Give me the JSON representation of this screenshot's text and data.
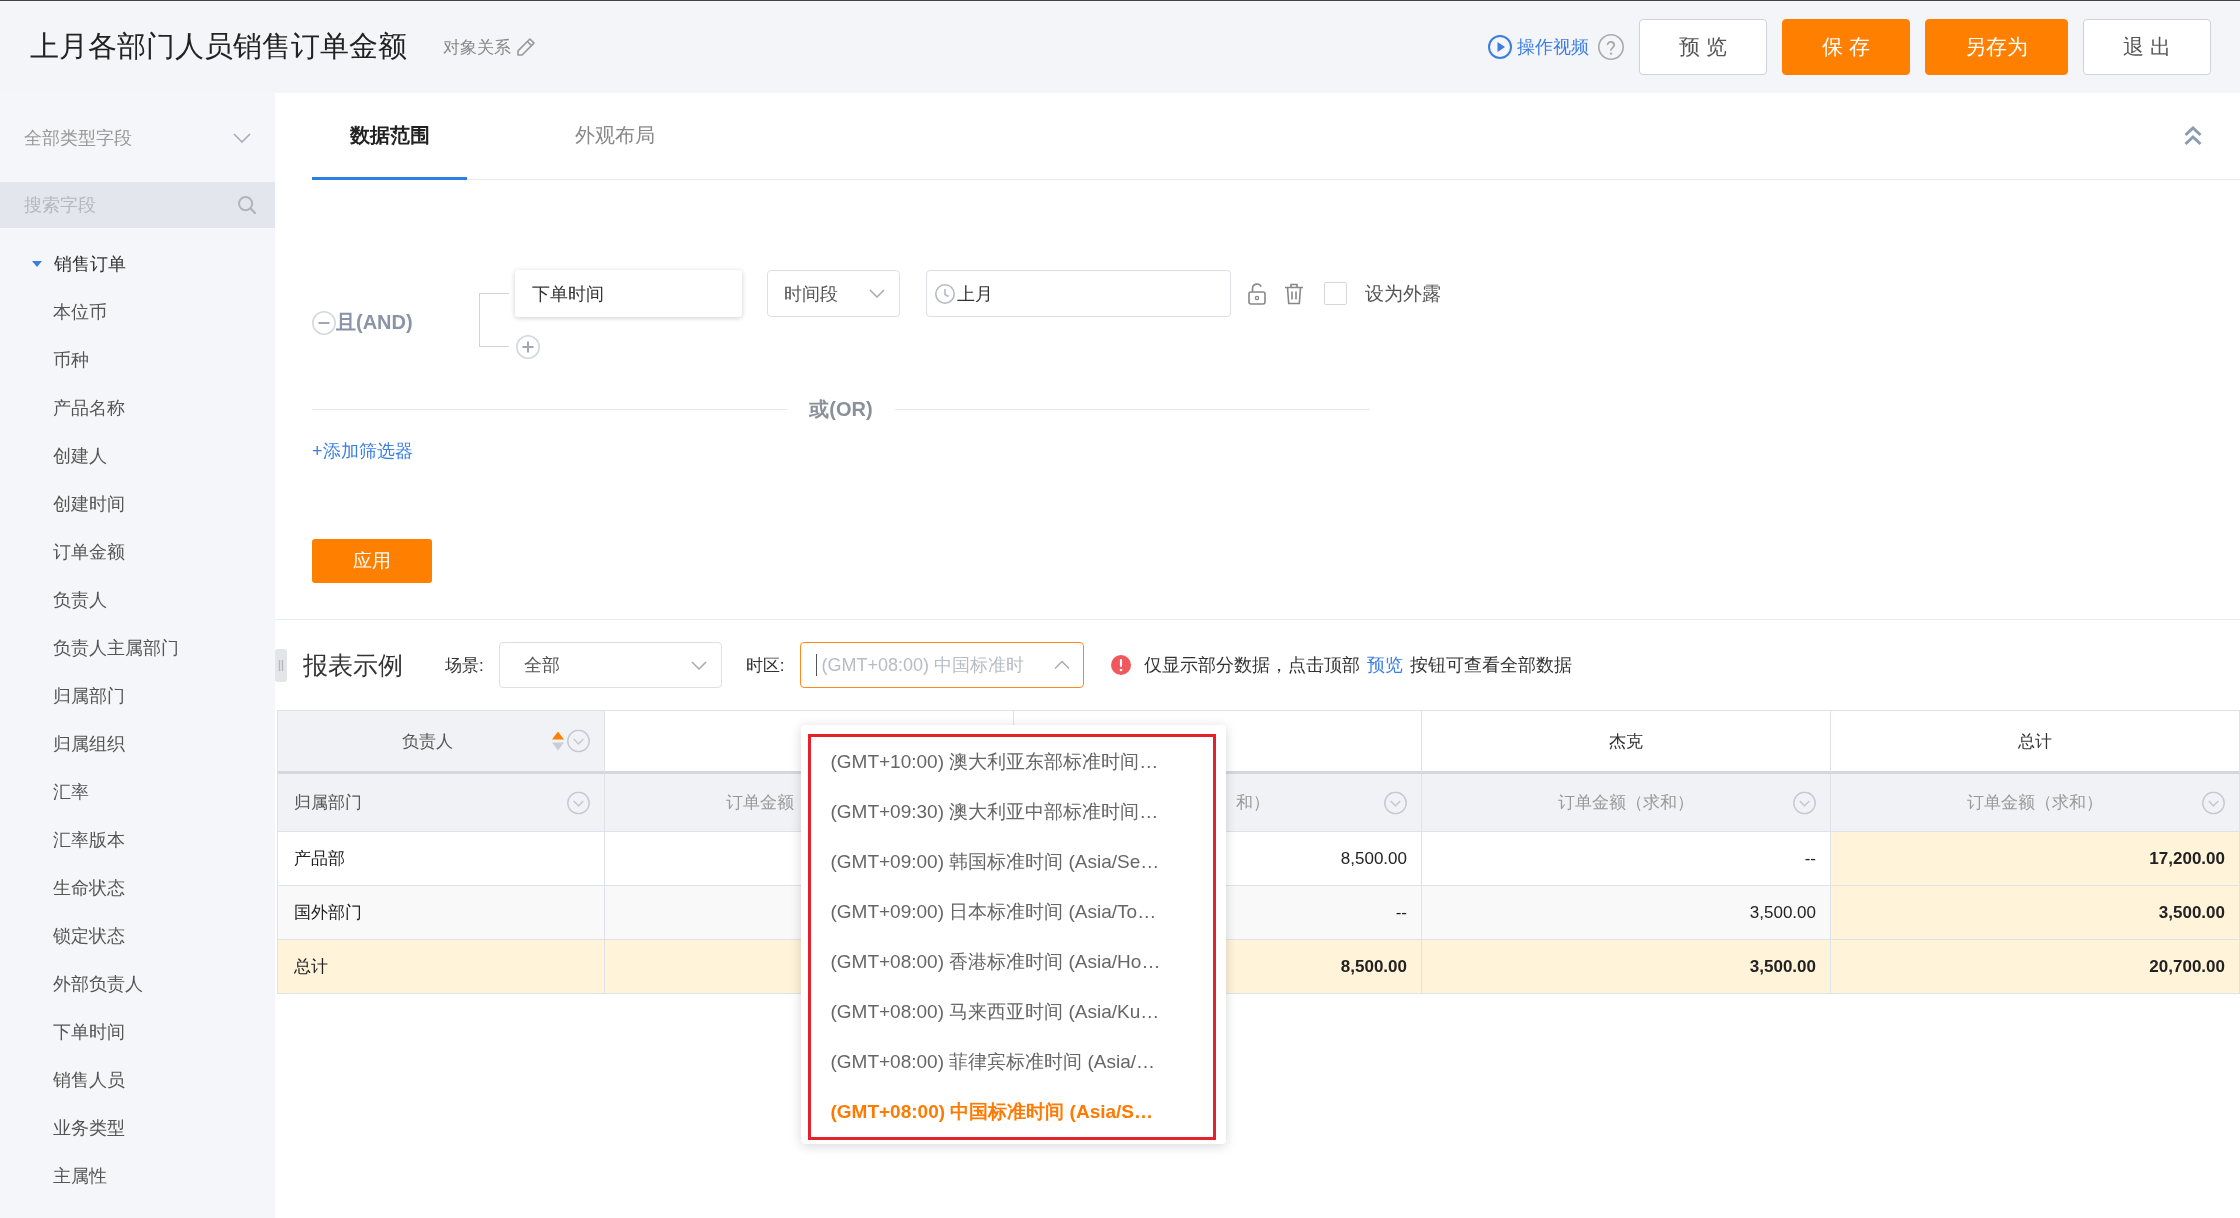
{
  "header": {
    "title": "上月各部门人员销售订单金额",
    "relation_label": "对象关系",
    "video_link": "操作视频",
    "buttons": [
      {
        "label": "预 览",
        "kind": "secondary"
      },
      {
        "label": "保 存",
        "kind": "primary"
      },
      {
        "label": "另存为",
        "kind": "primary"
      },
      {
        "label": "退 出",
        "kind": "secondary"
      }
    ]
  },
  "sidebar": {
    "type_select": "全部类型字段",
    "search": {
      "placeholder": "搜索字段"
    },
    "tree": [
      {
        "label": "销售订单",
        "expanded": true,
        "children": [
          {
            "label": "本位币"
          },
          {
            "label": "币种"
          },
          {
            "label": "产品名称"
          },
          {
            "label": "创建人"
          },
          {
            "label": "创建时间"
          },
          {
            "label": "订单金额"
          },
          {
            "label": "负责人"
          },
          {
            "label": "负责人主属部门"
          },
          {
            "label": "归属部门"
          },
          {
            "label": "归属组织"
          },
          {
            "label": "汇率"
          },
          {
            "label": "汇率版本"
          },
          {
            "label": "生命状态"
          },
          {
            "label": "锁定状态"
          },
          {
            "label": "外部负责人"
          },
          {
            "label": "下单时间"
          },
          {
            "label": "销售人员"
          },
          {
            "label": "业务类型"
          },
          {
            "label": "主属性"
          }
        ]
      }
    ]
  },
  "tabs": [
    {
      "label": "数据范围",
      "selected": true
    },
    {
      "label": "外观布局",
      "selected": false
    }
  ],
  "filter": {
    "logic_label": "且(AND)",
    "conditions": [
      {
        "field": "下单时间",
        "operator": "时间段",
        "value": "上月",
        "exposed": false,
        "exposed_label": "设为外露"
      }
    ],
    "or_label": "或(OR)",
    "add_filter": "+添加筛选器",
    "apply_button": "应用"
  },
  "report": {
    "title": "报表示例",
    "scene_label": "场景:",
    "scene_value": "全部",
    "timezone": {
      "label": "时区:",
      "placeholder": "(GMT+08:00) 中国标准时",
      "open": true,
      "highlighted": true,
      "options": [
        {
          "label": "(GMT+10:00) 澳大利亚东部标准时间…",
          "selected": false
        },
        {
          "label": "(GMT+09:30) 澳大利亚中部标准时间…",
          "selected": false
        },
        {
          "label": "(GMT+09:00) 韩国标准时间 (Asia/Se…",
          "selected": false
        },
        {
          "label": "(GMT+09:00) 日本标准时间 (Asia/To…",
          "selected": false
        },
        {
          "label": "(GMT+08:00) 香港标准时间 (Asia/Ho…",
          "selected": false
        },
        {
          "label": "(GMT+08:00) 马来西亚时间 (Asia/Ku…",
          "selected": false
        },
        {
          "label": "(GMT+08:00) 菲律宾标准时间 (Asia/…",
          "selected": false
        },
        {
          "label": "(GMT+08:00) 中国标准时间 (Asia/S…",
          "selected": true
        }
      ]
    },
    "notice": {
      "before": "仅显示部分数据，点击顶部",
      "link": "预览",
      "after": "按钮可查看全部数据"
    }
  },
  "table": {
    "columns": [
      {
        "heading": "负责人",
        "subheading": "归属部门",
        "sort_ascending": true
      },
      {
        "subheading": "订单金额"
      },
      {
        "subheading": "和）"
      },
      {
        "heading": "杰克",
        "subheading": "订单金额（求和）"
      },
      {
        "heading": "总计",
        "subheading": "订单金额（求和）",
        "total": true
      }
    ],
    "rows": [
      {
        "label": "产品部",
        "total": false,
        "cells": [
          "8,500.00",
          "--",
          "17,200.00"
        ]
      },
      {
        "label": "国外部门",
        "total": false,
        "cells": [
          "--",
          "3,500.00",
          "3,500.00"
        ]
      },
      {
        "label": "总计",
        "total": true,
        "cells": [
          "8,500.00",
          "3,500.00",
          "20,700.00"
        ]
      }
    ]
  }
}
